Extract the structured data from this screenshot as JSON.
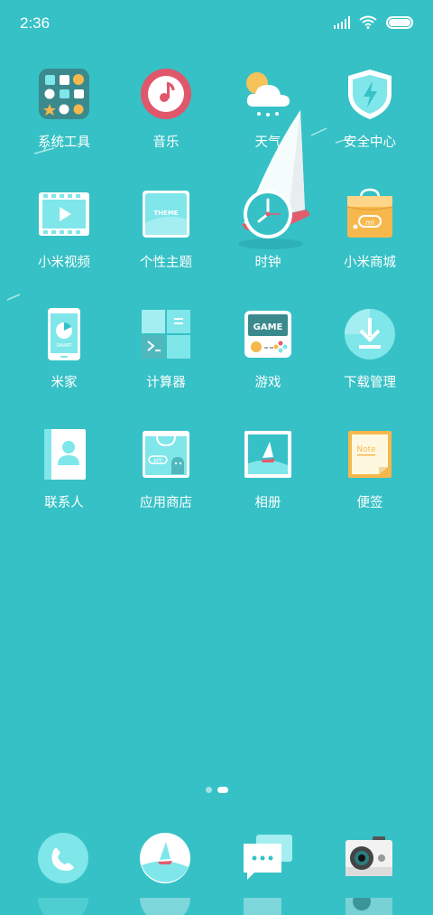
{
  "status": {
    "time": "2:36"
  },
  "apps": [
    {
      "label": "系统工具",
      "icon": "system-tools-icon"
    },
    {
      "label": "音乐",
      "icon": "music-icon"
    },
    {
      "label": "天气",
      "icon": "weather-icon"
    },
    {
      "label": "安全中心",
      "icon": "security-icon"
    },
    {
      "label": "小米视频",
      "icon": "video-icon"
    },
    {
      "label": "个性主题",
      "icon": "theme-icon"
    },
    {
      "label": "时钟",
      "icon": "clock-icon"
    },
    {
      "label": "小米商城",
      "icon": "mall-icon"
    },
    {
      "label": "米家",
      "icon": "mijia-icon"
    },
    {
      "label": "计算器",
      "icon": "calculator-icon"
    },
    {
      "label": "游戏",
      "icon": "game-icon"
    },
    {
      "label": "下载管理",
      "icon": "download-icon"
    },
    {
      "label": "联系人",
      "icon": "contacts-icon"
    },
    {
      "label": "应用商店",
      "icon": "app-store-icon"
    },
    {
      "label": "相册",
      "icon": "gallery-icon"
    },
    {
      "label": "便签",
      "icon": "notes-icon"
    }
  ],
  "icon_text": {
    "theme": "THEME",
    "mijia": "SMART",
    "game": "GAME",
    "notes": "Note",
    "mall": "mi",
    "app_store": "APP"
  },
  "dock": [
    {
      "icon": "phone-icon"
    },
    {
      "icon": "browser-icon"
    },
    {
      "icon": "messages-icon"
    },
    {
      "icon": "camera-icon"
    }
  ],
  "pages": {
    "count": 2,
    "active": 1
  },
  "colors": {
    "wallpaper": "#36c1c6",
    "icon_light": "#7fe6ea",
    "music_red": "#e0566a",
    "notes_yellow": "#f6b84c"
  }
}
